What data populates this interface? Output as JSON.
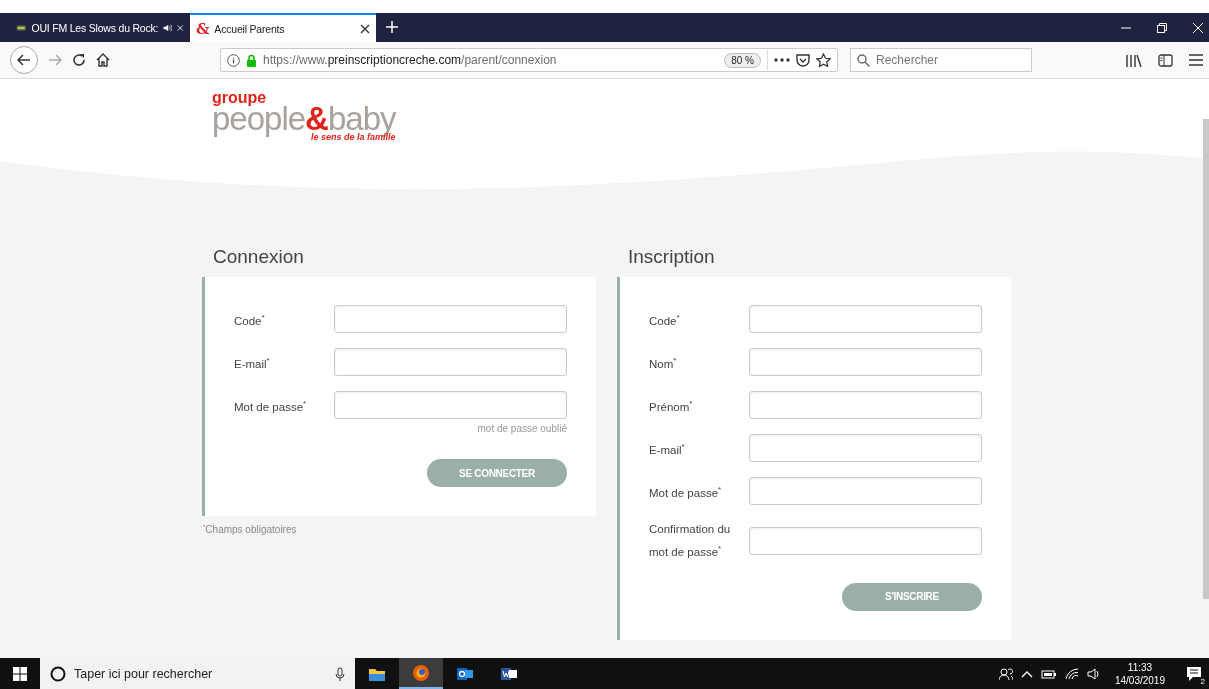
{
  "browser": {
    "tabs": [
      {
        "title": "OUI FM Les Slows du Rock:",
        "selected": false,
        "audio": true,
        "kind": "radio"
      },
      {
        "title": "Accueil Parents",
        "selected": true,
        "audio": false,
        "kind": "ampersand",
        "icon_text": "&"
      }
    ],
    "url": {
      "prefix": "https://www.",
      "domain": "preinscriptioncreche.com",
      "path": "/parent/connexion"
    },
    "zoom": "80 %",
    "search": {
      "placeholder": "Rechercher"
    }
  },
  "logo": {
    "top": "groupe",
    "left": "people",
    "mark": "&",
    "right": "baby",
    "tagline": "le sens de la famille"
  },
  "connexion": {
    "title": "Connexion",
    "fields": [
      {
        "label": "Code$^{*}$"
      },
      {
        "label": "E-mail$^{*}$"
      },
      {
        "label": "Mot de passe$^{*}$"
      }
    ],
    "forgot_link": "mot de passe oublié",
    "button": "SE CONNECTER"
  },
  "required_note": "$^{*}$Champs obligatoires",
  "inscription": {
    "title": "Inscription",
    "fields": [
      {
        "label": "Code$^{*}$"
      },
      {
        "label": "Nom$^{*}$"
      },
      {
        "label": "Prénom$^{*}$"
      },
      {
        "label": "E-mail$^{*}$"
      },
      {
        "label": "Mot de passe$^{*}$"
      },
      {
        "label": "Confirmation du mot de passe$^{*}$"
      }
    ],
    "button": "S'INSCRIRE"
  },
  "taskbar": {
    "search_placeholder": "Taper ici pour rechercher",
    "apps": [
      {
        "kind": "folder",
        "active": false
      },
      {
        "kind": "firefox",
        "active": true
      },
      {
        "kind": "outlook",
        "active": false
      },
      {
        "kind": "word",
        "active": false
      }
    ],
    "time": "11:33",
    "date": "14/03/2019",
    "notifications": "2"
  }
}
